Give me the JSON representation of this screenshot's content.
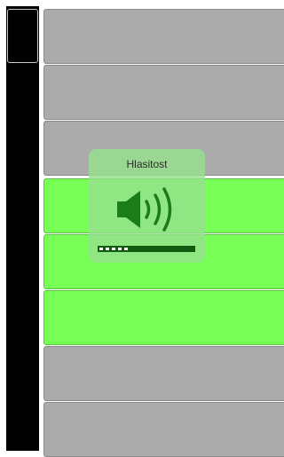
{
  "app": {
    "window_title": "",
    "rows": [
      {
        "id": 1,
        "state": "inactive",
        "color": "#ababab"
      },
      {
        "id": 2,
        "state": "inactive",
        "color": "#ababab"
      },
      {
        "id": 3,
        "state": "inactive",
        "color": "#ababab"
      },
      {
        "id": 4,
        "state": "active",
        "color": "#77ff55"
      },
      {
        "id": 5,
        "state": "active",
        "color": "#77ff55"
      },
      {
        "id": 6,
        "state": "active",
        "color": "#77ff55"
      },
      {
        "id": 7,
        "state": "inactive",
        "color": "#ababab"
      },
      {
        "id": 8,
        "state": "inactive",
        "color": "#ababab"
      }
    ]
  },
  "volume_hud": {
    "title": "Hlasitost",
    "icon": "speaker-volume-icon",
    "level_fraction": 0.31,
    "segments_total": 16,
    "segments_filled": 5,
    "accent": "#1a7d1a"
  }
}
